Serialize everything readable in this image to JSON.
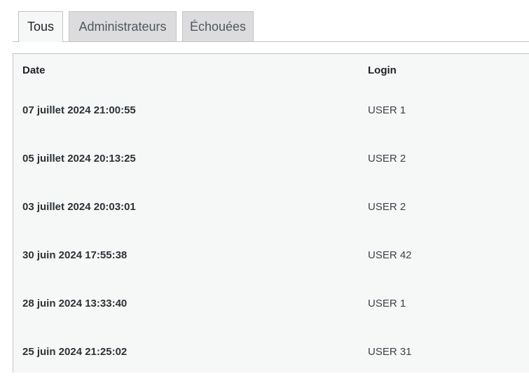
{
  "tabs": [
    {
      "label": "Tous",
      "active": true
    },
    {
      "label": "Administrateurs",
      "active": false
    },
    {
      "label": "Échouées",
      "active": false
    }
  ],
  "table": {
    "columns": [
      "Date",
      "Login"
    ],
    "rows": [
      {
        "date": "07 juillet 2024 21:00:55",
        "login": "USER 1"
      },
      {
        "date": "05 juillet 2024 20:13:25",
        "login": "USER 2"
      },
      {
        "date": "03 juillet 2024 20:03:01",
        "login": "USER 2"
      },
      {
        "date": "30 juin 2024 17:55:38",
        "login": "USER 42"
      },
      {
        "date": "28 juin 2024 13:33:40",
        "login": "USER 1"
      },
      {
        "date": "25 juin 2024 21:25:02",
        "login": "USER 31"
      }
    ]
  }
}
